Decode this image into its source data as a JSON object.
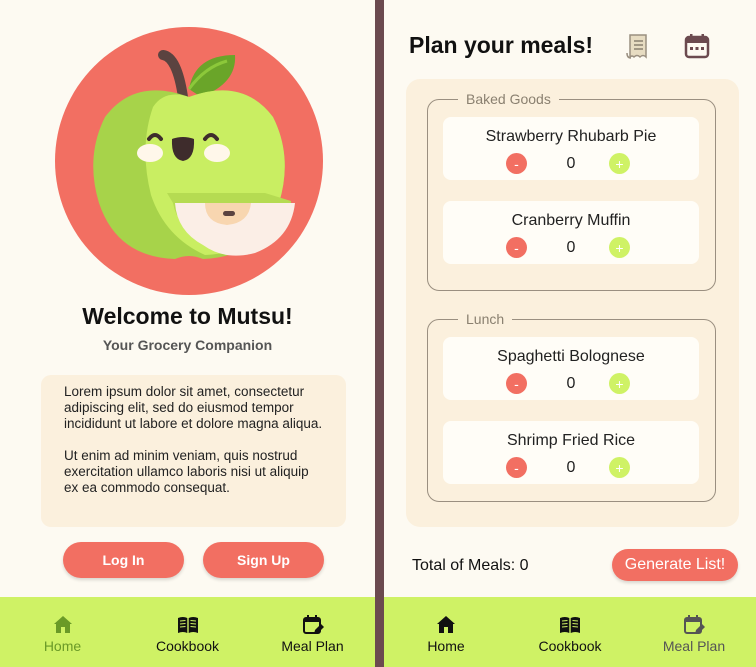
{
  "colors": {
    "divider": "#6b4a4f",
    "background": "#fdfaf2",
    "card": "#fbf0dd",
    "accent_red": "#f26f62",
    "accent_green": "#cff265",
    "nav_active": "#6a9a27"
  },
  "welcome": {
    "title": "Welcome to Mutsu!",
    "subtitle": "Your Grocery Companion",
    "paragraph1": "Lorem ipsum dolor sit amet, consectetur adipiscing elit, sed do eiusmod tempor incididunt ut labore et dolore magna aliqua.",
    "paragraph2": "Ut enim ad minim veniam, quis nostrud exercitation ullamco laboris nisi ut aliquip ex ea commodo consequat.",
    "login_label": "Log In",
    "signup_label": "Sign Up",
    "logo_icon": "apple-mascot-icon"
  },
  "nav": {
    "home": "Home",
    "cookbook": "Cookbook",
    "meal_plan": "Meal Plan"
  },
  "plan": {
    "title": "Plan your meals!",
    "receipt_icon": "receipt-icon",
    "calendar_icon": "calendar-icon",
    "categories": [
      {
        "name": "Baked Goods",
        "meals": [
          {
            "name": "Strawberry Rhubarb Pie",
            "count": "0"
          },
          {
            "name": "Cranberry Muffin",
            "count": "0"
          }
        ]
      },
      {
        "name": "Lunch",
        "meals": [
          {
            "name": "Spaghetti Bolognese",
            "count": "0"
          },
          {
            "name": "Shrimp Fried Rice",
            "count": "0"
          }
        ]
      }
    ],
    "minus_symbol": "-",
    "plus_symbol": "+",
    "total_label": "Total of Meals: 0",
    "generate_label": "Generate List!"
  }
}
